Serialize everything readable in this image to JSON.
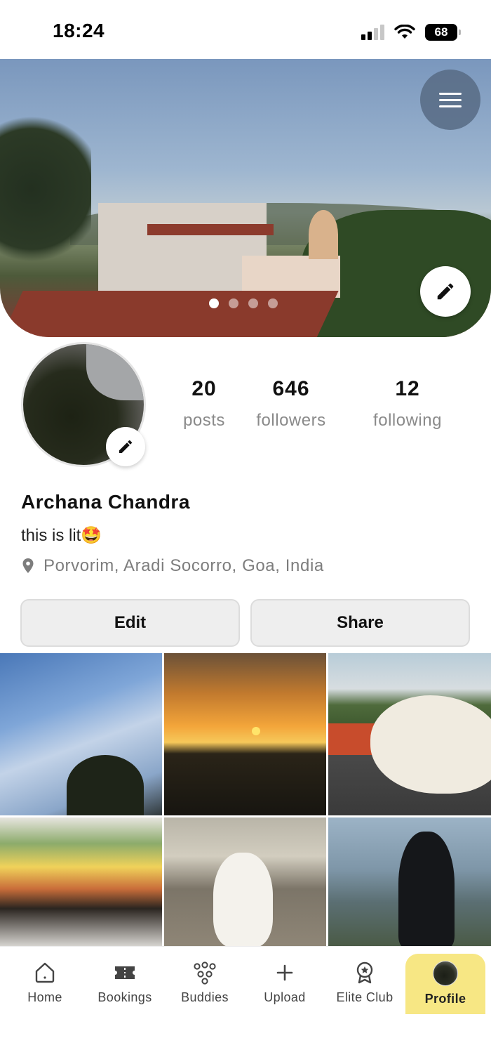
{
  "status_bar": {
    "time": "18:24",
    "battery": "68"
  },
  "profile": {
    "name": "Archana Chandra",
    "bio": "this is lit🤩",
    "location": "Porvorim, Aradi Socorro, Goa, India",
    "cover_carousel": {
      "total_dots": 4,
      "active_index": 0
    }
  },
  "stats": [
    {
      "value": "20",
      "label": "posts"
    },
    {
      "value": "646",
      "label": "followers"
    },
    {
      "value": "12",
      "label": "following"
    }
  ],
  "actions": {
    "edit": "Edit",
    "share": "Share"
  },
  "icons": {
    "menu": "hamburger-menu-icon",
    "cover_edit": "pencil-icon",
    "avatar_edit": "pencil-icon",
    "location": "location-pin-icon"
  },
  "tabs": [
    {
      "label": "Home",
      "icon": "home-icon",
      "active": false
    },
    {
      "label": "Bookings",
      "icon": "ticket-icon",
      "active": false
    },
    {
      "label": "Buddies",
      "icon": "people-icon",
      "active": false
    },
    {
      "label": "Upload",
      "icon": "plus-icon",
      "active": false
    },
    {
      "label": "Elite Club",
      "icon": "award-badge-icon",
      "active": false
    },
    {
      "label": "Profile",
      "icon": "profile-avatar",
      "active": true
    }
  ],
  "colors": {
    "active_tab": "#f7e784",
    "button_bg": "#eeeeee",
    "muted_text": "#8a8a8a"
  }
}
